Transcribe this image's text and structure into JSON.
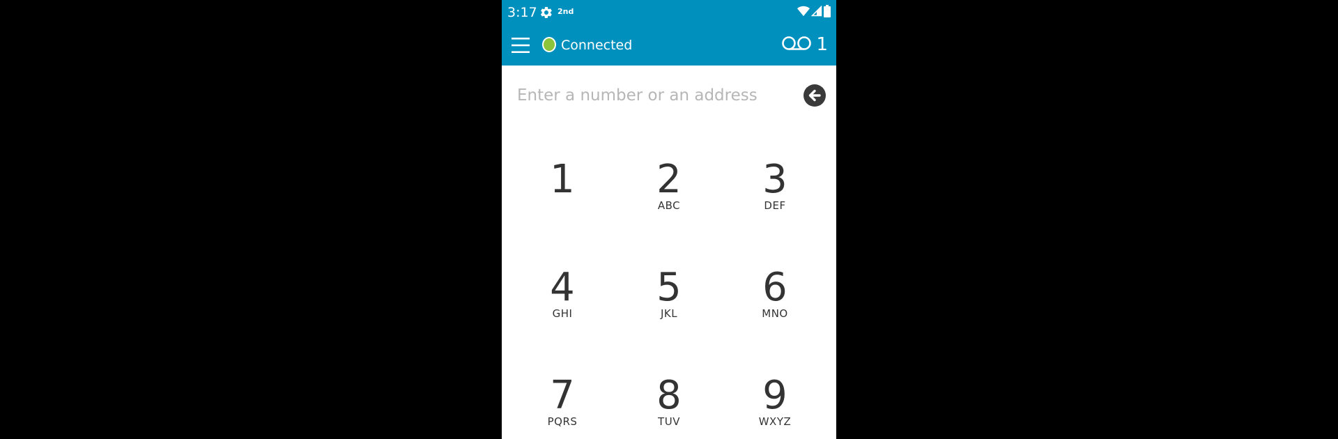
{
  "status_bar": {
    "time": "3:17",
    "badge": "2nd",
    "icons": [
      "gear-icon",
      "wifi-icon",
      "signal-icon",
      "battery-icon"
    ]
  },
  "app_bar": {
    "menu_icon": "hamburger-menu-icon",
    "connection_status": "Connected",
    "connection_color": "#8cc43c",
    "voicemail_icon": "voicemail-icon",
    "voicemail_count": "1",
    "background_color": "#0090bd"
  },
  "dialer": {
    "input_value": "",
    "input_placeholder": "Enter a number or an address",
    "backspace_icon": "backspace-arrow-icon"
  },
  "keypad": {
    "keys": [
      {
        "digit": "1",
        "letters": ""
      },
      {
        "digit": "2",
        "letters": "ABC"
      },
      {
        "digit": "3",
        "letters": "DEF"
      },
      {
        "digit": "4",
        "letters": "GHI"
      },
      {
        "digit": "5",
        "letters": "JKL"
      },
      {
        "digit": "6",
        "letters": "MNO"
      },
      {
        "digit": "7",
        "letters": "PQRS"
      },
      {
        "digit": "8",
        "letters": "TUV"
      },
      {
        "digit": "9",
        "letters": "WXYZ"
      }
    ]
  }
}
